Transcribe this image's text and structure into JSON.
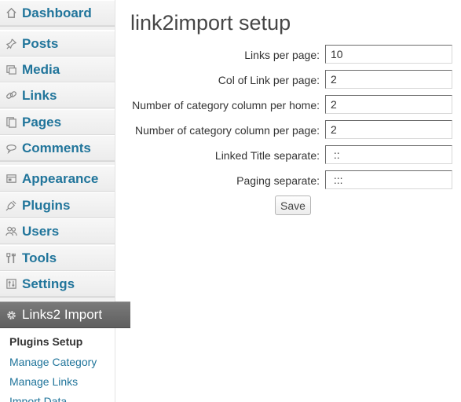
{
  "sidebar": {
    "items": [
      {
        "label": "Dashboard",
        "icon": "dashboard-icon"
      },
      {
        "label": "Posts",
        "icon": "pushpin-icon"
      },
      {
        "label": "Media",
        "icon": "media-icon"
      },
      {
        "label": "Links",
        "icon": "link-icon"
      },
      {
        "label": "Pages",
        "icon": "pages-icon"
      },
      {
        "label": "Comments",
        "icon": "comment-icon"
      },
      {
        "label": "Appearance",
        "icon": "appearance-icon"
      },
      {
        "label": "Plugins",
        "icon": "plug-icon"
      },
      {
        "label": "Users",
        "icon": "users-icon"
      },
      {
        "label": "Tools",
        "icon": "tools-icon"
      },
      {
        "label": "Settings",
        "icon": "settings-icon"
      }
    ],
    "current": {
      "label": "Links2 Import",
      "icon": "gear-icon"
    },
    "submenu": [
      {
        "label": "Plugins Setup",
        "active": true
      },
      {
        "label": "Manage Category",
        "active": false
      },
      {
        "label": "Manage Links",
        "active": false
      },
      {
        "label": "Import Data",
        "active": false
      }
    ]
  },
  "main": {
    "title": "link2import setup",
    "fields": [
      {
        "label": "Links per page:",
        "value": "10"
      },
      {
        "label": "Col of Link per page:",
        "value": "2"
      },
      {
        "label": "Number of category column per home:",
        "value": "2"
      },
      {
        "label": "Number of category column per page:",
        "value": "2"
      },
      {
        "label": "Linked Title separate:",
        "value": " ::"
      },
      {
        "label": "Paging separate:",
        "value": " :::"
      }
    ],
    "save_label": "Save"
  },
  "colors": {
    "link": "#21759b",
    "current_bg": "#6d6d6d",
    "sidebar_bg": "#f1f1f1"
  }
}
